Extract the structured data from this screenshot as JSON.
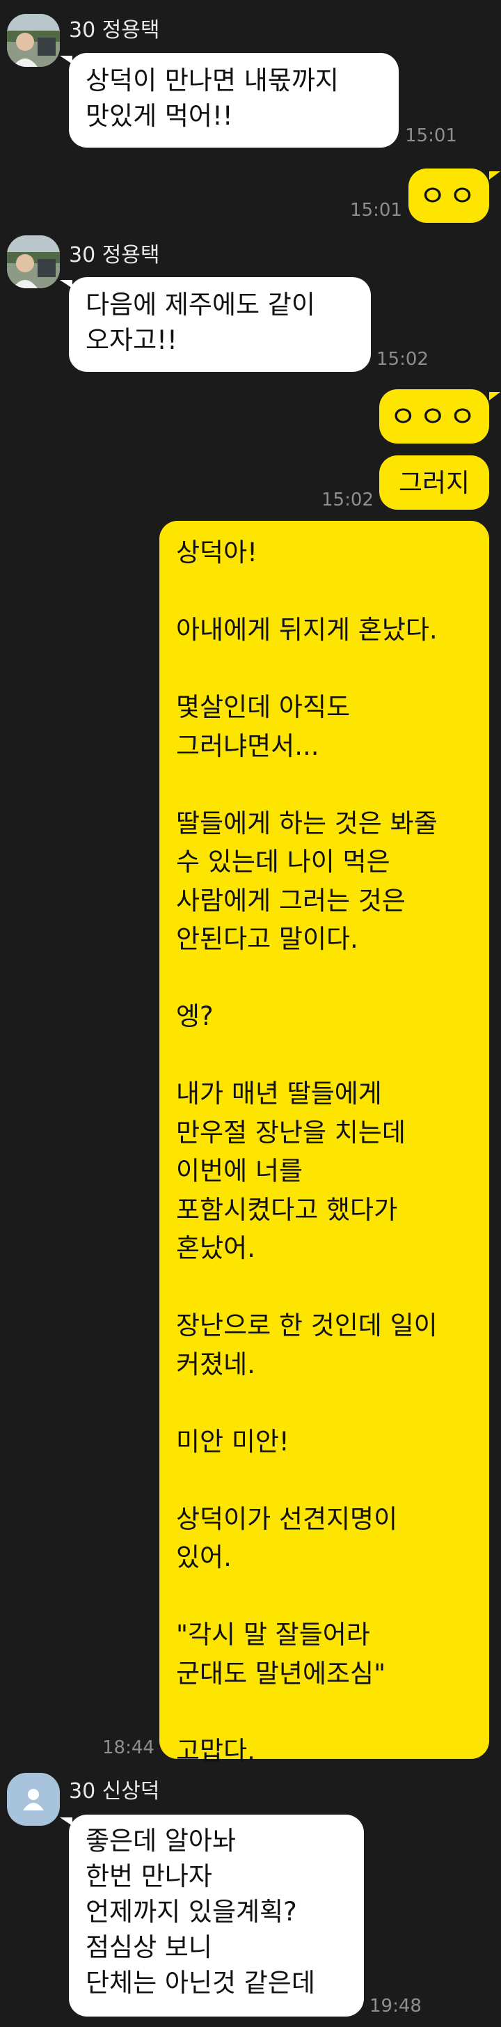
{
  "colors": {
    "background": "#1b1b1b",
    "incoming_bubble": "#ffffff",
    "outgoing_bubble": "#fee500",
    "timestamp": "#8e8e8e"
  },
  "messages": [
    {
      "type": "incoming",
      "sender": "30 정용택",
      "avatar": "photo-avatar",
      "text": "상덕이 만나면 내몫까지\n맛있게 먹어!!",
      "time": "15:01"
    },
    {
      "type": "outgoing",
      "text": "ㅇㅇ",
      "time": "15:01"
    },
    {
      "type": "incoming",
      "sender": "30 정용택",
      "avatar": "photo-avatar",
      "text": "다음에 제주에도 같이\n오자고!!",
      "time": "15:02"
    },
    {
      "type": "outgoing",
      "text": "ㅇㅇㅇ",
      "time": ""
    },
    {
      "type": "outgoing",
      "text": "그러지",
      "time": "15:02"
    },
    {
      "type": "outgoing",
      "text": "상덕아!\n\n아내에게 뒤지게 혼났다.\n\n몇살인데 아직도\n그러냐면서...\n\n딸들에게 하는 것은 봐줄\n수 있는데 나이 먹은\n사람에게 그러는 것은\n안된다고 말이다.\n\n엥?\n\n내가 매년 딸들에게\n만우절 장난을 치는데\n이번에 너를\n포함시켰다고 했다가\n혼났어.\n\n장난으로 한 것인데 일이\n커졌네.\n\n미안 미안!\n\n상덕이가 선견지명이\n있어.\n\n\"각시 말 잘들어라\n군대도 말년에조심\"\n\n고맙다.",
      "time": "18:44"
    },
    {
      "type": "incoming",
      "sender": "30 신상덕",
      "avatar": "default-person-avatar",
      "text": "좋은데 알아놔\n한번 만나자\n언제까지 있을계획?\n점심상 보니\n단체는 아닌것 같은데",
      "time": "19:48"
    }
  ]
}
